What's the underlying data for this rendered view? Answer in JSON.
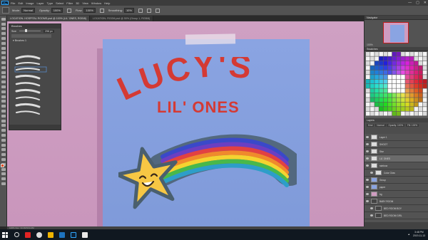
{
  "menubar": {
    "logo": "Ps",
    "items": [
      "File",
      "Edit",
      "Image",
      "Layer",
      "Type",
      "Select",
      "Filter",
      "3D",
      "View",
      "Window",
      "Help"
    ],
    "window_controls": [
      "—",
      "▢",
      "✕"
    ]
  },
  "optionsbar": {
    "mode_label": "Mode:",
    "mode_value": "Normal",
    "opacity_label": "Opacity:",
    "opacity_value": "100%",
    "flow_label": "Flow:",
    "flow_value": "100%",
    "smoothing_label": "Smoothing:",
    "smoothing_value": "10%"
  },
  "tabs": [
    {
      "label": "LOCATION- HOSPITAL ROOMS.psd @ 100% (LIL' ONES, RGB/8)",
      "active": true
    },
    {
      "label": "LOCATION- ROOM.psd @ 50% (Group 1, RGB/8)",
      "active": false
    }
  ],
  "brush_panel": {
    "title": "Brushes",
    "size_label": "Size",
    "size_value": "298 px",
    "folder_label": "Brushes 1"
  },
  "canvas": {
    "title": "LUCY'S",
    "subtitle": "LIL' ONES"
  },
  "statusbar": {
    "text": "100%   Doc: 34.3M/134.2M"
  },
  "right_panels": {
    "navigator_title": "Navigator",
    "navigator_zoom": "100%",
    "swatches_title": "Swatches",
    "layers_title": "Layers",
    "layer_kind": "Kind",
    "layer_blend": "Normal",
    "layer_opacity": "Opacity: 100%",
    "layer_fill": "Fill: 100%",
    "layers": [
      {
        "name": "Layer 1",
        "thumb": "white",
        "selected": false,
        "indent": false
      },
      {
        "name": "SHOOT",
        "thumb": "white",
        "selected": false,
        "indent": false
      },
      {
        "name": "Star",
        "thumb": "white",
        "selected": false,
        "indent": false
      },
      {
        "name": "LIL' ONES",
        "thumb": "white",
        "selected": true,
        "indent": false
      },
      {
        "name": "rainbow",
        "thumb": "white",
        "selected": false,
        "indent": false
      },
      {
        "name": "Color Glow",
        "thumb": "white",
        "selected": false,
        "indent": true
      },
      {
        "name": "Group",
        "thumb": "blue",
        "selected": false,
        "indent": false
      },
      {
        "name": "paper",
        "thumb": "blue",
        "selected": false,
        "indent": false
      },
      {
        "name": "bg",
        "thumb": "pink",
        "selected": false,
        "indent": false
      },
      {
        "name": "BABY ROOM",
        "thumb": "dark",
        "selected": false,
        "indent": false
      },
      {
        "name": "BED ROOM BOY",
        "thumb": "dark",
        "selected": false,
        "indent": true
      },
      {
        "name": "BED ROOM GIRL",
        "thumb": "dark",
        "selected": false,
        "indent": true
      }
    ]
  },
  "taskbar": {
    "time": "3:48 PM",
    "date": "2019-11-13"
  },
  "colors": {
    "wall": "#cf9cc1",
    "paper": "#8aa4e2",
    "title_red": "#d43a34",
    "star_yellow": "#f7c744",
    "foreground": "#e34a1e"
  }
}
